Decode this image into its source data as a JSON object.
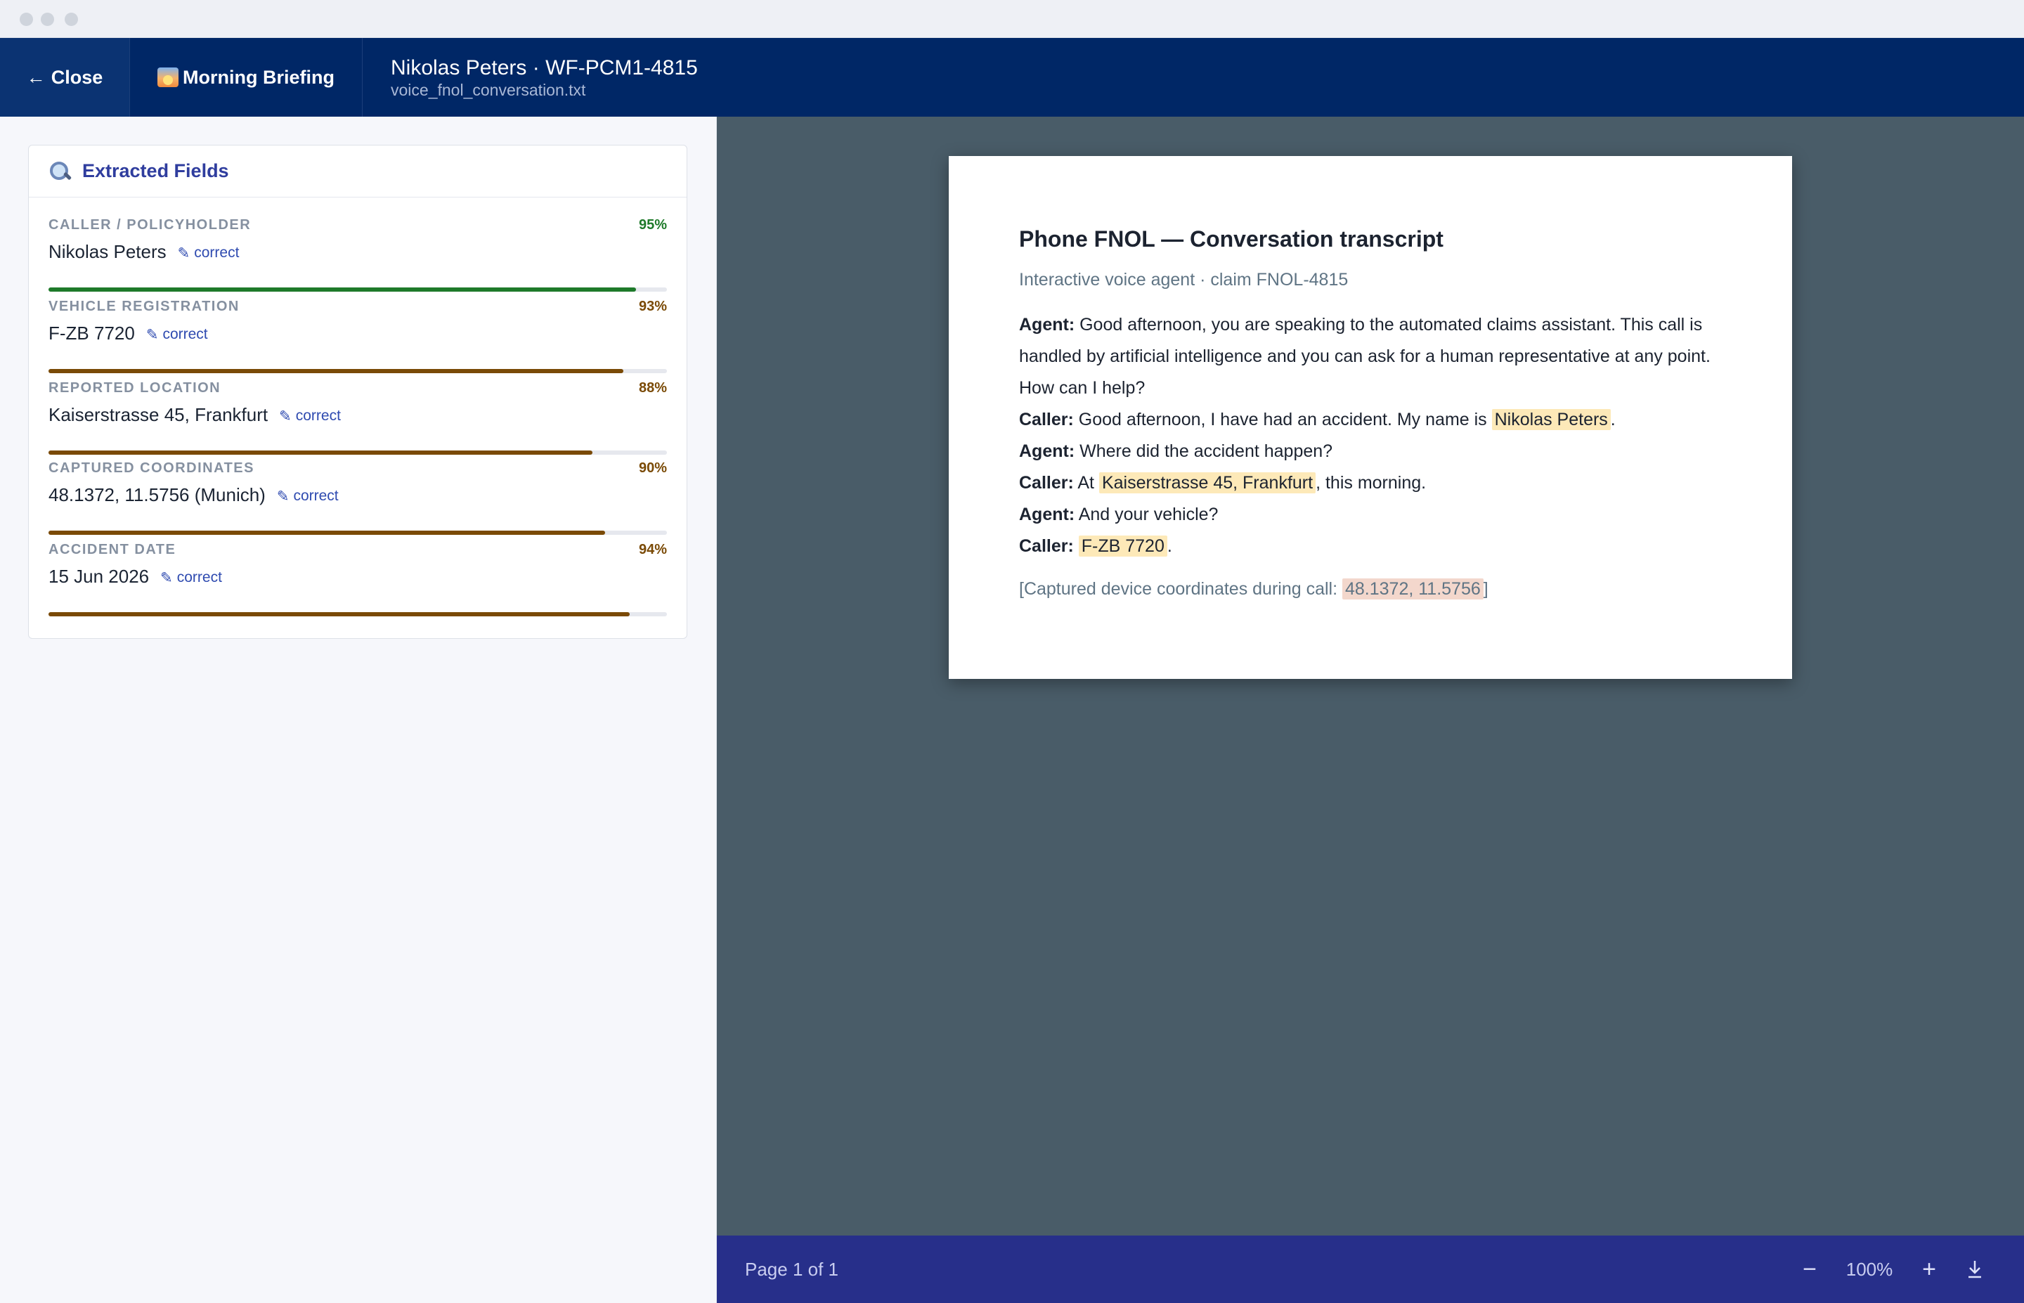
{
  "window": {
    "close_label": "Close",
    "close_arrow": "←",
    "briefing_label": "Morning Briefing",
    "title": "Nikolas Peters · WF-PCM1-4815",
    "filename": "voice_fnol_conversation.txt"
  },
  "fields_panel": {
    "title": "Extracted Fields",
    "correct_label": "correct",
    "fields": [
      {
        "label": "CALLER / POLICYHOLDER",
        "value": "Nikolas Peters",
        "confidence_text": "95%",
        "confidence": 0.95,
        "color": "#1e7a2a"
      },
      {
        "label": "VEHICLE REGISTRATION",
        "value": "F-ZB 7720",
        "confidence_text": "93%",
        "confidence": 0.93,
        "color": "#7a4a06"
      },
      {
        "label": "REPORTED LOCATION",
        "value": "Kaiserstrasse 45, Frankfurt",
        "confidence_text": "88%",
        "confidence": 0.88,
        "color": "#7a4a06"
      },
      {
        "label": "CAPTURED COORDINATES",
        "value": "48.1372, 11.5756 (Munich)",
        "confidence_text": "90%",
        "confidence": 0.9,
        "color": "#7a4a06"
      },
      {
        "label": "ACCIDENT DATE",
        "value": "15 Jun 2026",
        "confidence_text": "94%",
        "confidence": 0.94,
        "color": "#7a4a06"
      }
    ]
  },
  "document": {
    "title": "Phone FNOL — Conversation transcript",
    "subtitle": "Interactive voice agent · claim FNOL-4815",
    "lines": {
      "l1_speaker": "Agent:",
      "l1_text": " Good afternoon, you are speaking to the automated claims assistant. This call is handled by artificial intelligence and you can ask for a human representative at any point. How can I help?",
      "l2_speaker": "Caller:",
      "l2_text_a": " Good afternoon, I have had an accident. My name is ",
      "l2_highlight": "Nikolas Peters",
      "l2_text_b": ".",
      "l3_speaker": "Agent:",
      "l3_text": " Where did the accident happen?",
      "l4_speaker": "Caller:",
      "l4_text_a": " At ",
      "l4_highlight": "Kaiserstrasse 45, Frankfurt",
      "l4_text_b": ", this morning.",
      "l5_speaker": "Agent:",
      "l5_text": " And your vehicle?",
      "l6_speaker": "Caller:",
      "l6_highlight": "F-ZB 7720",
      "l6_text_b": "."
    },
    "captured_prefix": "[Captured device coordinates during call: ",
    "captured_value": "48.1372, 11.5756",
    "captured_suffix": "]"
  },
  "footer": {
    "page_indicator": "Page 1 of 1",
    "zoom_out": "−",
    "zoom_level": "100%",
    "zoom_in": "+"
  }
}
